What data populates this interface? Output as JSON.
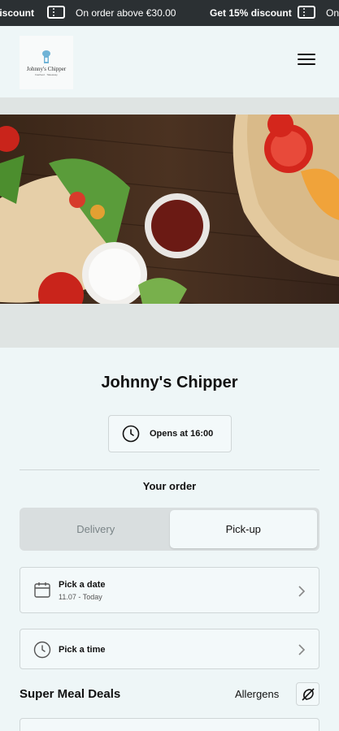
{
  "promo_banner": {
    "items": [
      "discount",
      "On order above €30.00",
      "Get 15% discount",
      "On"
    ],
    "icon": "ticket-icon"
  },
  "header": {
    "logo_name": "Johnny's Chipper",
    "logo_sub": "Fastfood · Takeaway",
    "menu_icon": "hamburger-menu-icon"
  },
  "hero": {
    "alt": "Wraps with tomatoes and dips on wooden board"
  },
  "restaurant": {
    "name": "Johnny's Chipper",
    "opens_label": "Opens at 16:00"
  },
  "order": {
    "heading": "Your order",
    "modes": [
      "Delivery",
      "Pick-up"
    ],
    "active_mode": "Pick-up",
    "date_label": "Pick a date",
    "date_value": "11.07 - Today",
    "time_label": "Pick a time"
  },
  "menu_section": {
    "title": "Super Meal Deals",
    "allergens_label": "Allergens"
  },
  "colors": {
    "background": "#eef6f7",
    "banner": "#2b3033",
    "border": "#cfd6d7"
  }
}
